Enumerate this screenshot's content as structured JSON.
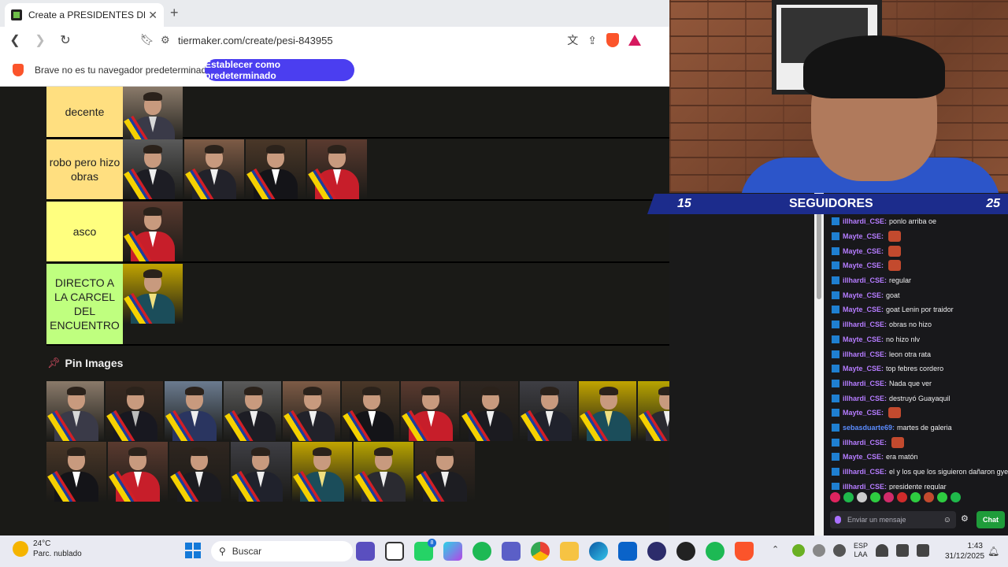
{
  "browser": {
    "tab_title": "Create a PRESIDENTES DE ECUA",
    "tab_close": "✕",
    "new_tab": "+",
    "url": "tiermaker.com/create/pesi-843955",
    "infobar_text": "Brave no es tu navegador predeterminado",
    "infobar_button": "Establecer como predeterminado"
  },
  "tiers": [
    {
      "label": "decente",
      "color": "#ffdf80",
      "count": 1
    },
    {
      "label": "robo pero hizo obras",
      "color": "#ffdf80",
      "count": 4
    },
    {
      "label": "asco",
      "color": "#ffff7f",
      "count": 1
    },
    {
      "label": "DIRECTO A LA CARCEL DEL ENCUENTRO",
      "color": "#bfff7f",
      "count": 1
    }
  ],
  "pin_images": {
    "title": "Pin Images",
    "row1_count": 13,
    "row2_count": 7
  },
  "overlay": {
    "left_num": "15",
    "label": "SEGUIDORES",
    "right_num": "25"
  },
  "chat": {
    "messages": [
      {
        "user": "illhardi_CSE",
        "text": "ponlo arriba oe",
        "color": "#b57cff",
        "emote": false
      },
      {
        "user": "Mayte_CSE",
        "text": "",
        "color": "#b57cff",
        "emote": true
      },
      {
        "user": "Mayte_CSE",
        "text": "",
        "color": "#b57cff",
        "emote": true
      },
      {
        "user": "Mayte_CSE",
        "text": "",
        "color": "#b57cff",
        "emote": true
      },
      {
        "user": "illhardi_CSE",
        "text": "regular",
        "color": "#b57cff",
        "emote": false
      },
      {
        "user": "Mayte_CSE",
        "text": "goat",
        "color": "#b57cff",
        "emote": false
      },
      {
        "user": "Mayte_CSE",
        "text": "goat Lenin por traidor",
        "color": "#b57cff",
        "emote": false
      },
      {
        "user": "illhardi_CSE",
        "text": "obras no hizo",
        "color": "#b57cff",
        "emote": false
      },
      {
        "user": "Mayte_CSE",
        "text": "no hizo nlv",
        "color": "#b57cff",
        "emote": false
      },
      {
        "user": "illhardi_CSE",
        "text": "leon otra rata",
        "color": "#b57cff",
        "emote": false
      },
      {
        "user": "Mayte_CSE",
        "text": "top febres cordero",
        "color": "#b57cff",
        "emote": false
      },
      {
        "user": "illhardi_CSE",
        "text": "Nada que ver",
        "color": "#b57cff",
        "emote": false
      },
      {
        "user": "illhardi_CSE",
        "text": "destruyó Guayaquil",
        "color": "#b57cff",
        "emote": false
      },
      {
        "user": "Mayte_CSE",
        "text": "",
        "color": "#b57cff",
        "emote": true
      },
      {
        "user": "sebasduarte69",
        "text": "martes de galeria",
        "color": "#5b8cff",
        "emote": false
      },
      {
        "user": "illhardi_CSE",
        "text": "",
        "color": "#b57cff",
        "emote": true
      },
      {
        "user": "Mayte_CSE",
        "text": "era matón",
        "color": "#b57cff",
        "emote": false
      },
      {
        "user": "illhardi_CSE",
        "text": "el y los que los siguieron dañaron gye",
        "color": "#b57cff",
        "emote": false
      },
      {
        "user": "illhardi_CSE",
        "text": "presidente regular",
        "color": "#b57cff",
        "emote": false
      }
    ],
    "input_placeholder": "Enviar un mensaje",
    "chat_button": "Chat"
  },
  "taskbar": {
    "temp": "24°C",
    "weather": "Parc. nublado",
    "search": "Buscar",
    "lang1": "ESP",
    "lang2": "LAA",
    "time": "1:43",
    "date": "31/12/2025",
    "whatsapp_badge": "8"
  }
}
